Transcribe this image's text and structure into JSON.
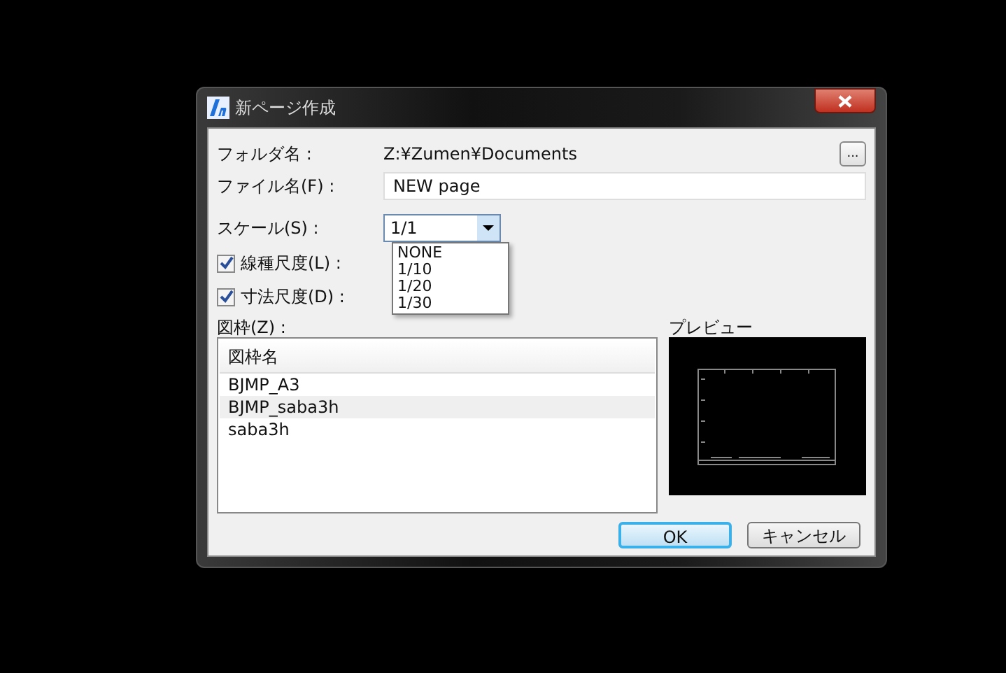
{
  "window": {
    "title": "新ページ作成"
  },
  "folder": {
    "label": "フォルダ名 :",
    "value": "Z:¥Zumen¥Documents",
    "browse_button": "..."
  },
  "file_name": {
    "label": "ファイル名(F) :",
    "value": "NEW page"
  },
  "scale": {
    "label": "スケール(S) :",
    "value": "1/1",
    "expanded": true,
    "options": [
      "NONE",
      "1/10",
      "1/20",
      "1/30"
    ]
  },
  "checkboxes": [
    {
      "label": "線種尺度(L) :",
      "checked": true
    },
    {
      "label": "寸法尺度(D) :",
      "checked": true
    }
  ],
  "frames": {
    "label": "図枠(Z) :",
    "column": "図枠名",
    "rows": [
      {
        "name": "BJMP_A3",
        "selected": false
      },
      {
        "name": "BJMP_saba3h",
        "selected": true
      },
      {
        "name": "saba3h",
        "selected": false
      }
    ]
  },
  "preview": {
    "label": "プレビュー"
  },
  "buttons": [
    {
      "label": "OK",
      "kind": "default"
    },
    {
      "label": "キャンセル",
      "kind": "normal"
    }
  ]
}
